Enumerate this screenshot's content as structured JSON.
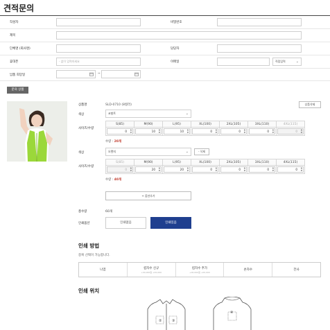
{
  "page": {
    "title": "견적문의"
  },
  "form": {
    "writer_label": "작성자",
    "password_label": "비밀번호",
    "subject_label": "제목",
    "company_label": "단체명 (회사명)",
    "manager_label": "담당자",
    "phone_label": "휴대폰",
    "phone_placeholder": "- 없이 입력하세요",
    "email_label": "이메일",
    "email_select": "직접입력",
    "date_label": "납품 희망일",
    "date_separator": "~"
  },
  "product": {
    "section_button": "문의 상품",
    "name_label": "상품명",
    "name_value": "SLD-0710 (8컬러)",
    "delete_product": "상품삭제",
    "color_label": "색상",
    "size_qty_label": "사이즈/수량",
    "sizes": [
      "S(85)",
      "M(90)",
      "L(95)",
      "XL(100)",
      "2XL(105)",
      "3XL(110)",
      "4XL(115)"
    ],
    "options": [
      {
        "color": "코발트",
        "quantities": [
          "0",
          "10",
          "10",
          "0",
          "0",
          "0",
          "0"
        ],
        "disabled": [
          false,
          false,
          false,
          false,
          false,
          false,
          true
        ],
        "sum_label": "수량 : ",
        "sum_value": "20개"
      },
      {
        "color": "오렌지",
        "delete": "- 삭제",
        "quantities": [
          "0",
          "20",
          "20",
          "0",
          "0",
          "0",
          "0"
        ],
        "disabled": [
          true,
          false,
          false,
          false,
          false,
          false,
          false
        ],
        "sum_label": "수량 : ",
        "sum_value": "40개"
      }
    ],
    "add_option": "+ 옵션추가",
    "total_label": "총수량",
    "total_value": "60개",
    "print_label": "인쇄옵션",
    "print_none": "인쇄없음",
    "print_yes": "인쇄있음"
  },
  "method": {
    "title": "인쇄 방법",
    "subtitle": "중복 선택이 가능합니다.",
    "options": [
      {
        "label": "나염",
        "sub": ""
      },
      {
        "label": "컴자수 신규",
        "sub": "+00,000원\n+00,000"
      },
      {
        "label": "컴자수 추가",
        "sub": "+00,000원\n+00,000"
      },
      {
        "label": "손자수",
        "sub": ""
      },
      {
        "label": "전사",
        "sub": ""
      }
    ]
  },
  "position": {
    "title": "인쇄 위치",
    "markers": [
      "①",
      "②",
      "③",
      "④"
    ]
  },
  "colors": {
    "accent": "#1f3f8f",
    "quantity_red": "#c0392b",
    "vest_green": "#9bd83a"
  }
}
